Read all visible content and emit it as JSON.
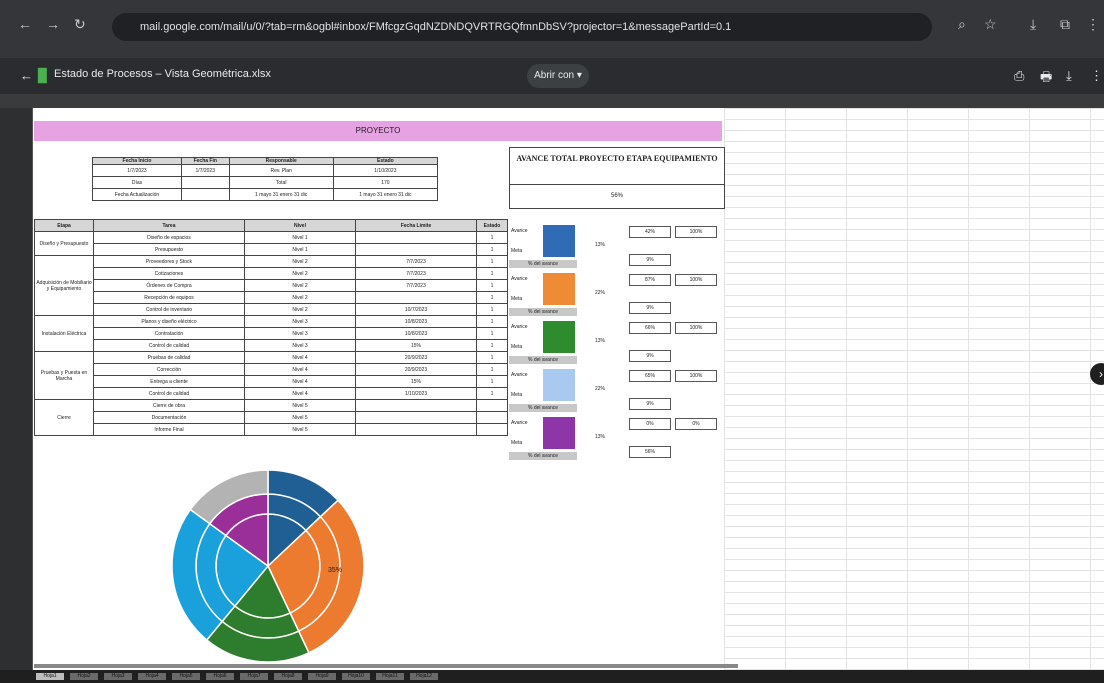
{
  "browser": {
    "url": "mail.google.com/mail/u/0/?tab=rm&ogbl#inbox/FMfcgzGqdNZDNDQVRTRGQfmnDbSV?projector=1&messagePartId=0.1"
  },
  "viewer": {
    "title": "Estado de Procesos – Vista Geométrica.xlsx",
    "open_with_label": "Abrir con ▾"
  },
  "sheet": {
    "band_title": "PROYECTO",
    "box_title": "AVANCE TOTAL PROYECTO ETAPA EQUIPAMIENTO",
    "box_value": "56%",
    "summary": {
      "headers": [
        "Fecha Inicio",
        "Fecha Fin",
        "Responsable",
        "Estado"
      ],
      "rows": [
        [
          "1/7/2023",
          "1/7/2023",
          "Rev. Plan",
          "1/10/2023"
        ],
        [
          "Días",
          "",
          "Total",
          "170"
        ],
        [
          "Fecha Actualización",
          "",
          "1 mayo 31 enero 31 dic",
          "1 mayo 31 enero 31 dic"
        ]
      ]
    },
    "main": {
      "headers": [
        "Etapa",
        "Tarea",
        "Nivel",
        "Fecha Límite",
        "Estado"
      ],
      "groups": [
        {
          "etapa": "Diseño y Presupuesto",
          "rows": [
            [
              "Diseño de espacios",
              "Nivel 1",
              "",
              "1"
            ],
            [
              "Presupuesto",
              "Nivel 1",
              "",
              "1"
            ]
          ]
        },
        {
          "etapa": "Adquisición de Mobiliario y Equipamiento",
          "rows": [
            [
              "Proveedores y Stock",
              "Nivel 2",
              "7/7/2023",
              "1"
            ],
            [
              "Cotizaciones",
              "Nivel 2",
              "7/7/2023",
              "1"
            ],
            [
              "Órdenes de Compra",
              "Nivel 2",
              "7/7/2023",
              "1"
            ],
            [
              "Recepción de equipos",
              "Nivel 2",
              "",
              "1"
            ],
            [
              "Control de inventario",
              "Nivel 2",
              "10/7/2023",
              "1"
            ]
          ]
        },
        {
          "etapa": "Instalación Eléctrica",
          "rows": [
            [
              "Planos y diseño eléctrico",
              "Nivel 3",
              "10/8/2023",
              "1"
            ],
            [
              "Contratación",
              "Nivel 3",
              "10/8/2023",
              "1"
            ],
            [
              "Control de calidad",
              "Nivel 3",
              "15%",
              "1"
            ]
          ]
        },
        {
          "etapa": "Pruebas y Puesta en Marcha",
          "rows": [
            [
              "Pruebas de calidad",
              "Nivel 4",
              "20/9/2023",
              "1"
            ],
            [
              "Corrección",
              "Nivel 4",
              "20/9/2023",
              "1"
            ],
            [
              "Entrega a cliente",
              "Nivel 4",
              "15%",
              "1"
            ],
            [
              "Control de calidad",
              "Nivel 4",
              "1/10/2023",
              "1"
            ]
          ]
        },
        {
          "etapa": "Cierre",
          "rows": [
            [
              "Cierre de obra",
              "Nivel 5",
              "",
              ""
            ],
            [
              "Documentación",
              "Nivel 5",
              "",
              ""
            ],
            [
              "Informe Final",
              "Nivel 5",
              "",
              ""
            ]
          ]
        }
      ]
    },
    "stages": [
      {
        "color": "#2f6cb5",
        "labels": [
          "Avance",
          "Meta"
        ],
        "pct": "13%",
        "c1": "42%",
        "c2": "100%",
        "c3": "9%",
        "cl": "% del avance"
      },
      {
        "color": "#ef8b34",
        "labels": [
          "Avance",
          "Meta"
        ],
        "pct": "22%",
        "c1": "87%",
        "c2": "100%",
        "c3": "9%",
        "cl": "% del avance"
      },
      {
        "color": "#2e8b2e",
        "labels": [
          "Avance",
          "Meta"
        ],
        "pct": "13%",
        "c1": "66%",
        "c2": "100%",
        "c3": "9%",
        "cl": "% del avance"
      },
      {
        "color": "#a9c9f0",
        "labels": [
          "Avance",
          "Meta"
        ],
        "pct": "22%",
        "c1": "65%",
        "c2": "100%",
        "c3": "9%",
        "cl": "% del avance"
      },
      {
        "color": "#8e35a8",
        "labels": [
          "Avance",
          "Meta"
        ],
        "pct": "13%",
        "c1": "0%",
        "c2": "0%",
        "c3": "56%",
        "cl": "% del avance"
      }
    ],
    "donut": {
      "label": "35%",
      "slices": [
        {
          "value": 13,
          "color": "#1f5f93"
        },
        {
          "value": 30,
          "color": "#ec7a2f"
        },
        {
          "value": 18,
          "color": "#2e7d2e"
        },
        {
          "value": 24,
          "color": "#1aa0db"
        },
        {
          "value": 15,
          "color": "#9a2f9a"
        }
      ],
      "outer_ring_gray_colors": [
        "#1f5f93",
        "#ec7a2f",
        "#2e7d2e",
        "#1aa0db",
        "#b3b3b3"
      ]
    },
    "tabs": [
      "Hoja1",
      "Hoja2",
      "Hoja3",
      "Hoja4",
      "Hoja5",
      "Hoja6",
      "Hoja7",
      "Hoja8",
      "Hoja9",
      "Hoja10",
      "Hoja11",
      "Hoja12"
    ]
  }
}
